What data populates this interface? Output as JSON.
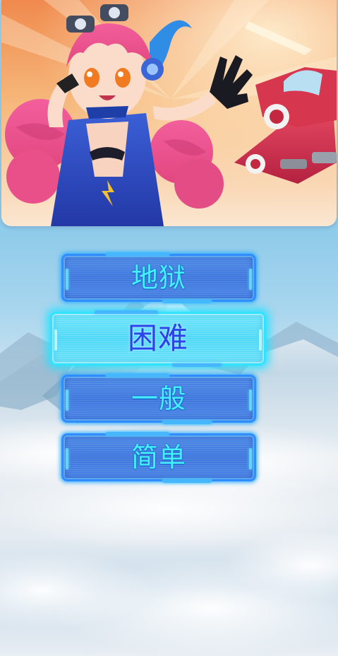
{
  "colors": {
    "button_fill": "#4a86e6",
    "button_border": "#2f8dff",
    "button_label": "#45f0ff",
    "selected_fill": "#5fdcf8",
    "selected_label": "#2a43ea",
    "sky": "#9fd3ef"
  },
  "banner": {
    "icon": "character-art-icon"
  },
  "difficulty": {
    "selected": "hard",
    "options": [
      {
        "key": "hell",
        "label": "地狱"
      },
      {
        "key": "hard",
        "label": "困难"
      },
      {
        "key": "normal",
        "label": "一般"
      },
      {
        "key": "easy",
        "label": "简单"
      }
    ]
  }
}
